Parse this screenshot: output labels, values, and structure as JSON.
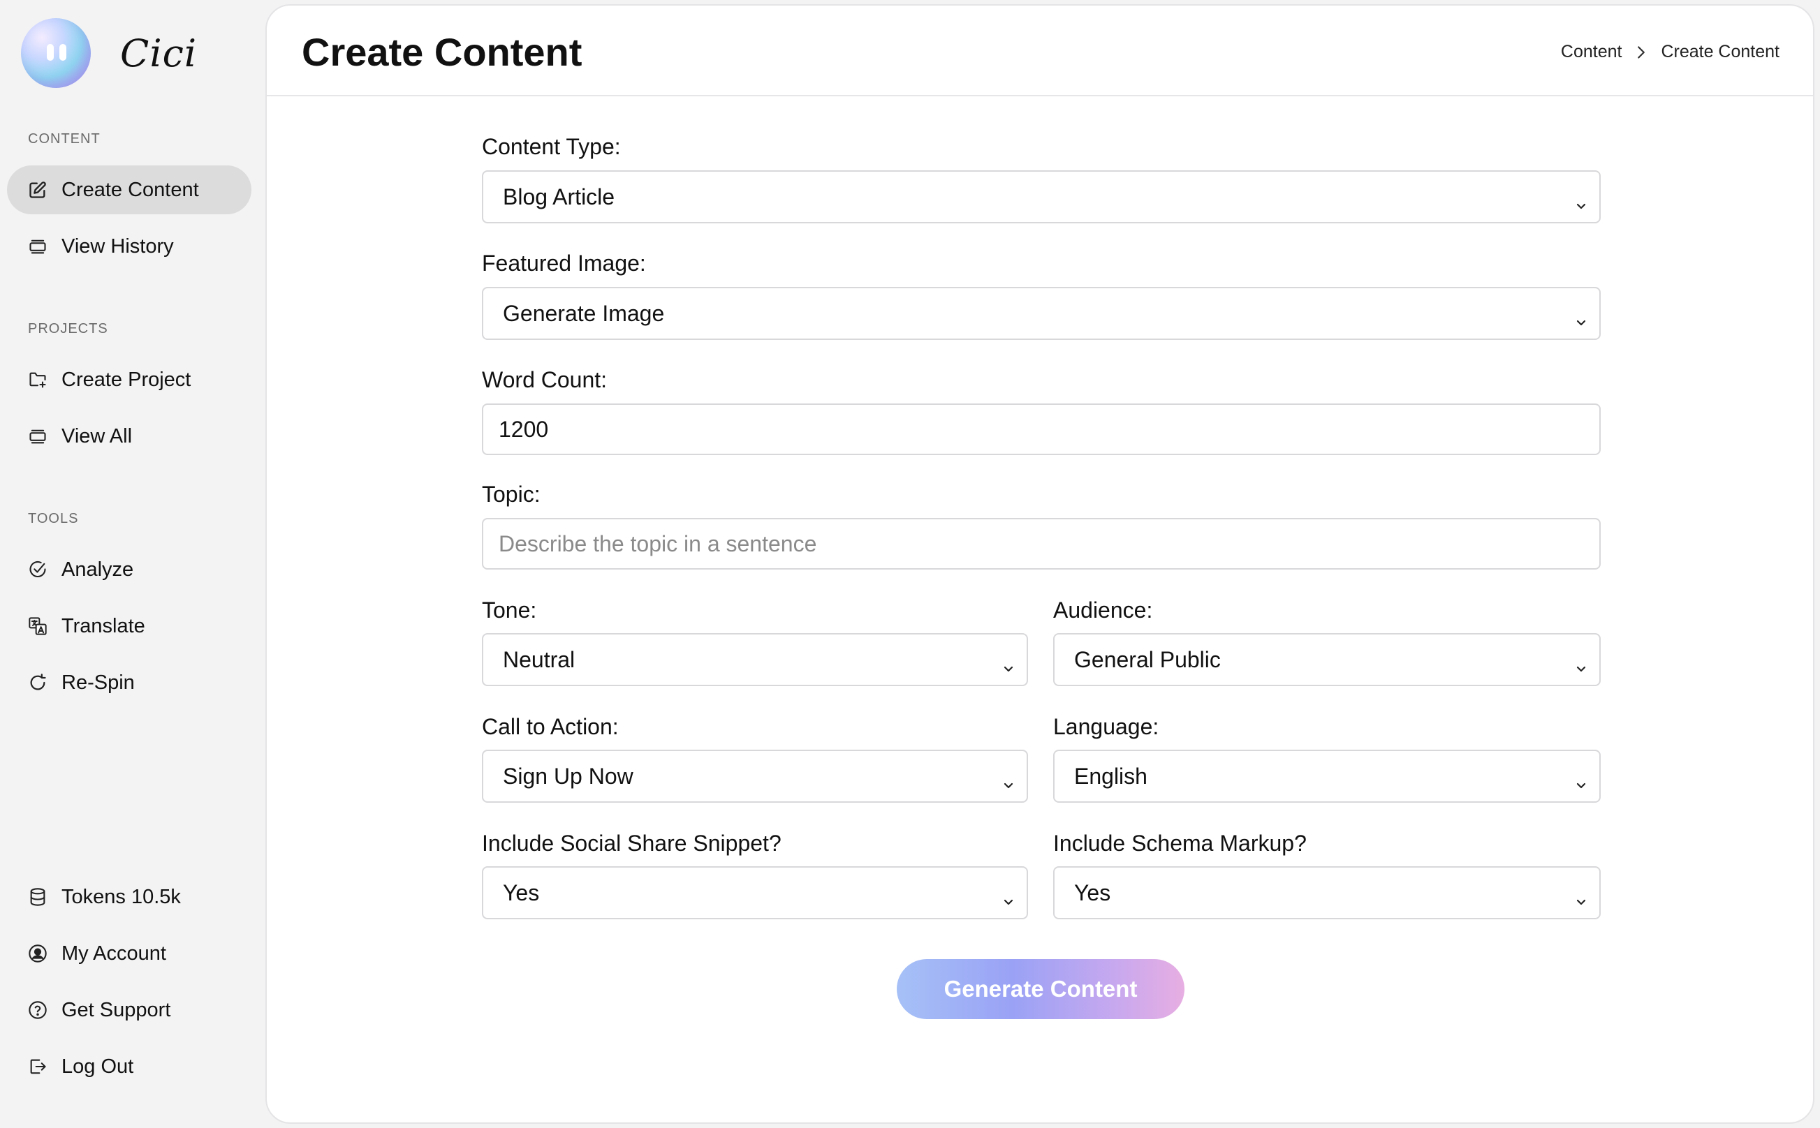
{
  "app": {
    "name": "Cici"
  },
  "sidebar": {
    "sections": [
      {
        "label": "CONTENT",
        "items": [
          {
            "label": "Create Content",
            "icon": "edit-icon",
            "active": true
          },
          {
            "label": "View History",
            "icon": "stack-icon",
            "active": false
          }
        ]
      },
      {
        "label": "PROJECTS",
        "items": [
          {
            "label": "Create Project",
            "icon": "folder-plus-icon",
            "active": false
          },
          {
            "label": "View All",
            "icon": "stack-icon",
            "active": false
          }
        ]
      },
      {
        "label": "TOOLS",
        "items": [
          {
            "label": "Analyze",
            "icon": "check-circle-icon",
            "active": false
          },
          {
            "label": "Translate",
            "icon": "translate-icon",
            "active": false
          },
          {
            "label": "Re-Spin",
            "icon": "refresh-icon",
            "active": false
          }
        ]
      }
    ],
    "footer": [
      {
        "label": "Tokens 10.5k",
        "icon": "database-icon"
      },
      {
        "label": "My Account",
        "icon": "user-circle-icon"
      },
      {
        "label": "Get Support",
        "icon": "help-circle-icon"
      },
      {
        "label": "Log Out",
        "icon": "logout-icon"
      }
    ]
  },
  "header": {
    "title": "Create Content",
    "breadcrumb": [
      "Content",
      "Create Content"
    ]
  },
  "form": {
    "content_type": {
      "label": "Content Type:",
      "value": "Blog Article"
    },
    "featured_image": {
      "label": "Featured Image:",
      "value": "Generate Image"
    },
    "word_count": {
      "label": "Word Count:",
      "value": "1200"
    },
    "topic": {
      "label": "Topic:",
      "value": "",
      "placeholder": "Describe the topic in a sentence"
    },
    "tone": {
      "label": "Tone:",
      "value": "Neutral"
    },
    "audience": {
      "label": "Audience:",
      "value": "General Public"
    },
    "call_to_action": {
      "label": "Call to Action:",
      "value": "Sign Up Now"
    },
    "language": {
      "label": "Language:",
      "value": "English"
    },
    "social_snippet": {
      "label": "Include Social Share Snippet?",
      "value": "Yes"
    },
    "schema_markup": {
      "label": "Include Schema Markup?",
      "value": "Yes"
    },
    "submit_label": "Generate Content"
  },
  "colors": {
    "active_nav_bg": "#dcdcdd",
    "button_gradient_start": "#a6c1f7",
    "button_gradient_end": "#e7aee2"
  }
}
